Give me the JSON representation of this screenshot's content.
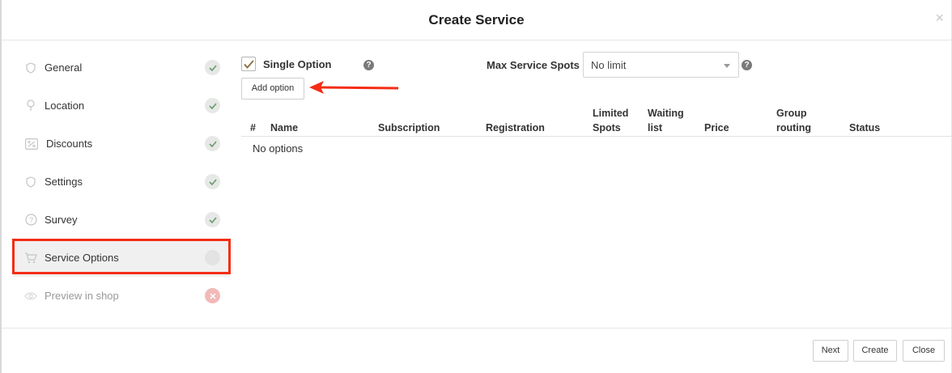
{
  "modal": {
    "title": "Create Service",
    "close_symbol": "×"
  },
  "sidebar": {
    "items": [
      {
        "label": "General",
        "icon": "shield-icon",
        "status": "complete"
      },
      {
        "label": "Location",
        "icon": "map-pin-icon",
        "status": "complete"
      },
      {
        "label": "Discounts",
        "icon": "percent-icon",
        "status": "complete"
      },
      {
        "label": "Settings",
        "icon": "shield-icon",
        "status": "complete"
      },
      {
        "label": "Survey",
        "icon": "question-circle-icon",
        "status": "complete"
      },
      {
        "label": "Service Options",
        "icon": "cart-icon",
        "status": "pending"
      },
      {
        "label": "Preview in shop",
        "icon": "eye-icon",
        "status": "error"
      }
    ],
    "active_item": "Service Options"
  },
  "options": {
    "single_option_label": "Single Option",
    "single_option_checked": true,
    "max_spots_label": "Max Service Spots",
    "max_spots_value": "No limit",
    "add_option_label": "Add option",
    "help_symbol": "?"
  },
  "table": {
    "columns": [
      "#",
      "Name",
      "Subscription",
      "Registration",
      "Limited Spots",
      "Waiting list",
      "Price",
      "Group routing",
      "Status"
    ],
    "column_lines": [
      [
        "#"
      ],
      [
        "Name"
      ],
      [
        "Subscription"
      ],
      [
        "Registration"
      ],
      [
        "Limited",
        "Spots"
      ],
      [
        "Waiting",
        "list"
      ],
      [
        "Price"
      ],
      [
        "Group",
        "routing"
      ],
      [
        "Status"
      ]
    ],
    "empty_text": "No options"
  },
  "footer": {
    "next_label": "Next",
    "create_label": "Create",
    "close_label": "Close"
  },
  "colors": {
    "highlight": "#f42d14",
    "check": "#6b9b6b",
    "error": "#f2b9b9"
  }
}
